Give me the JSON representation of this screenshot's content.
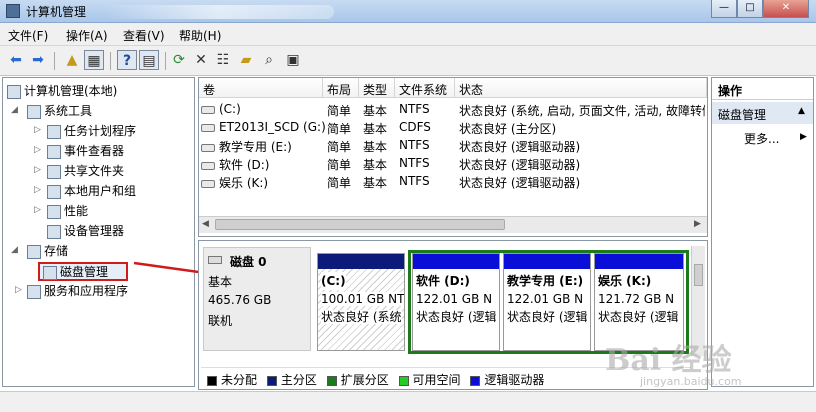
{
  "window": {
    "title": "计算机管理",
    "btn_min": "—",
    "btn_max": "□",
    "btn_close": "✕"
  },
  "menu": [
    "文件(F)",
    "操作(A)",
    "查看(V)",
    "帮助(H)"
  ],
  "tree": {
    "root": "计算机管理(本地)",
    "system_tools": "系统工具",
    "task_scheduler": "任务计划程序",
    "event_viewer": "事件查看器",
    "shared_folders": "共享文件夹",
    "local_users": "本地用户和组",
    "performance": "性能",
    "device_manager": "设备管理器",
    "storage": "存储",
    "disk_management": "磁盘管理",
    "services": "服务和应用程序"
  },
  "volumes": {
    "headers": [
      "卷",
      "布局",
      "类型",
      "文件系统",
      "状态"
    ],
    "rows": [
      [
        "(C:)",
        "简单",
        "基本",
        "NTFS",
        "状态良好 (系统, 启动, 页面文件, 活动, 故障转储"
      ],
      [
        "ET2013I_SCD (G:)",
        "简单",
        "基本",
        "CDFS",
        "状态良好 (主分区)"
      ],
      [
        "教学专用 (E:)",
        "简单",
        "基本",
        "NTFS",
        "状态良好 (逻辑驱动器)"
      ],
      [
        "软件 (D:)",
        "简单",
        "基本",
        "NTFS",
        "状态良好 (逻辑驱动器)"
      ],
      [
        "娱乐 (K:)",
        "简单",
        "基本",
        "NTFS",
        "状态良好 (逻辑驱动器)"
      ]
    ]
  },
  "disk": {
    "name": "磁盘 0",
    "type": "基本",
    "size": "465.76 GB",
    "status": "联机",
    "partitions": [
      {
        "name": "(C:)",
        "size": "100.01 GB NT",
        "status": "状态良好 (系统"
      },
      {
        "name": "软件 (D:)",
        "size": "122.01 GB N",
        "status": "状态良好 (逻辑"
      },
      {
        "name": "教学专用 (E:)",
        "size": "122.01 GB N",
        "status": "状态良好 (逻辑"
      },
      {
        "name": "娱乐 (K:)",
        "size": "121.72 GB N",
        "status": "状态良好 (逻辑"
      }
    ]
  },
  "legend": [
    {
      "label": "未分配",
      "color": "#000000"
    },
    {
      "label": "主分区",
      "color": "#0c1a7a"
    },
    {
      "label": "扩展分区",
      "color": "#1b7a1b"
    },
    {
      "label": "可用空间",
      "color": "#22cc22"
    },
    {
      "label": "逻辑驱动器",
      "color": "#0a0fd8"
    }
  ],
  "actions": {
    "title": "操作",
    "section": "磁盘管理",
    "more": "更多..."
  },
  "watermark": {
    "main": "Bai 经验",
    "sub": "jingyan.baidu.com"
  }
}
